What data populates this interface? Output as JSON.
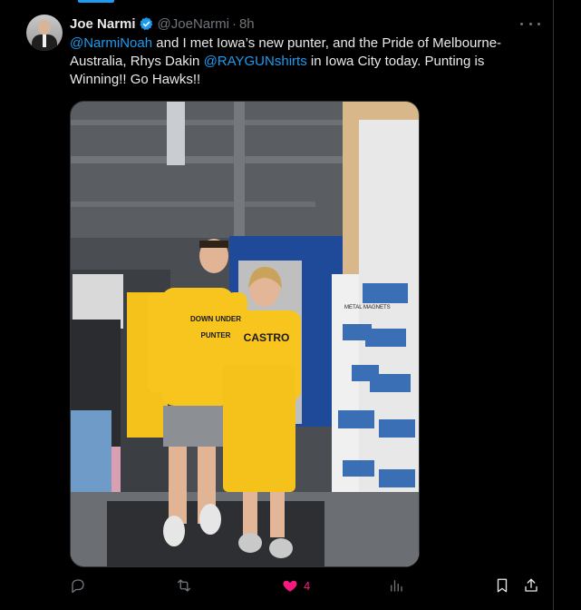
{
  "colors": {
    "background": "#000000",
    "text": "#e7e9ea",
    "muted": "#71767b",
    "link": "#1d9bf0",
    "like": "#f91880"
  },
  "tweet": {
    "display_name": "Joe Narmi",
    "verified_icon": "verified-badge-icon",
    "handle": "@JoeNarmi",
    "separator": "·",
    "time": "8h",
    "text": {
      "mention1": "@NarmiNoah",
      "part1": " and I met Iowa’s new punter, and the Pride of Melbourne-Australia, Rhys Dakin ",
      "mention2": "@RAYGUNshirts",
      "part2": " in Iowa City today.  Punting is Winning!!  Go Hawks!!"
    },
    "media": {
      "shirt_left_line1": "DOWN UNDER",
      "shirt_left_line2": "PUNTER",
      "shirt_right": "CASTRO",
      "sign": "METAL MAGNETS"
    }
  },
  "actions": {
    "reply_icon": "reply-icon",
    "repost_icon": "repost-icon",
    "like_icon": "heart-icon",
    "like_count": "4",
    "views_icon": "analytics-icon",
    "bookmark_icon": "bookmark-icon",
    "share_icon": "share-icon"
  }
}
